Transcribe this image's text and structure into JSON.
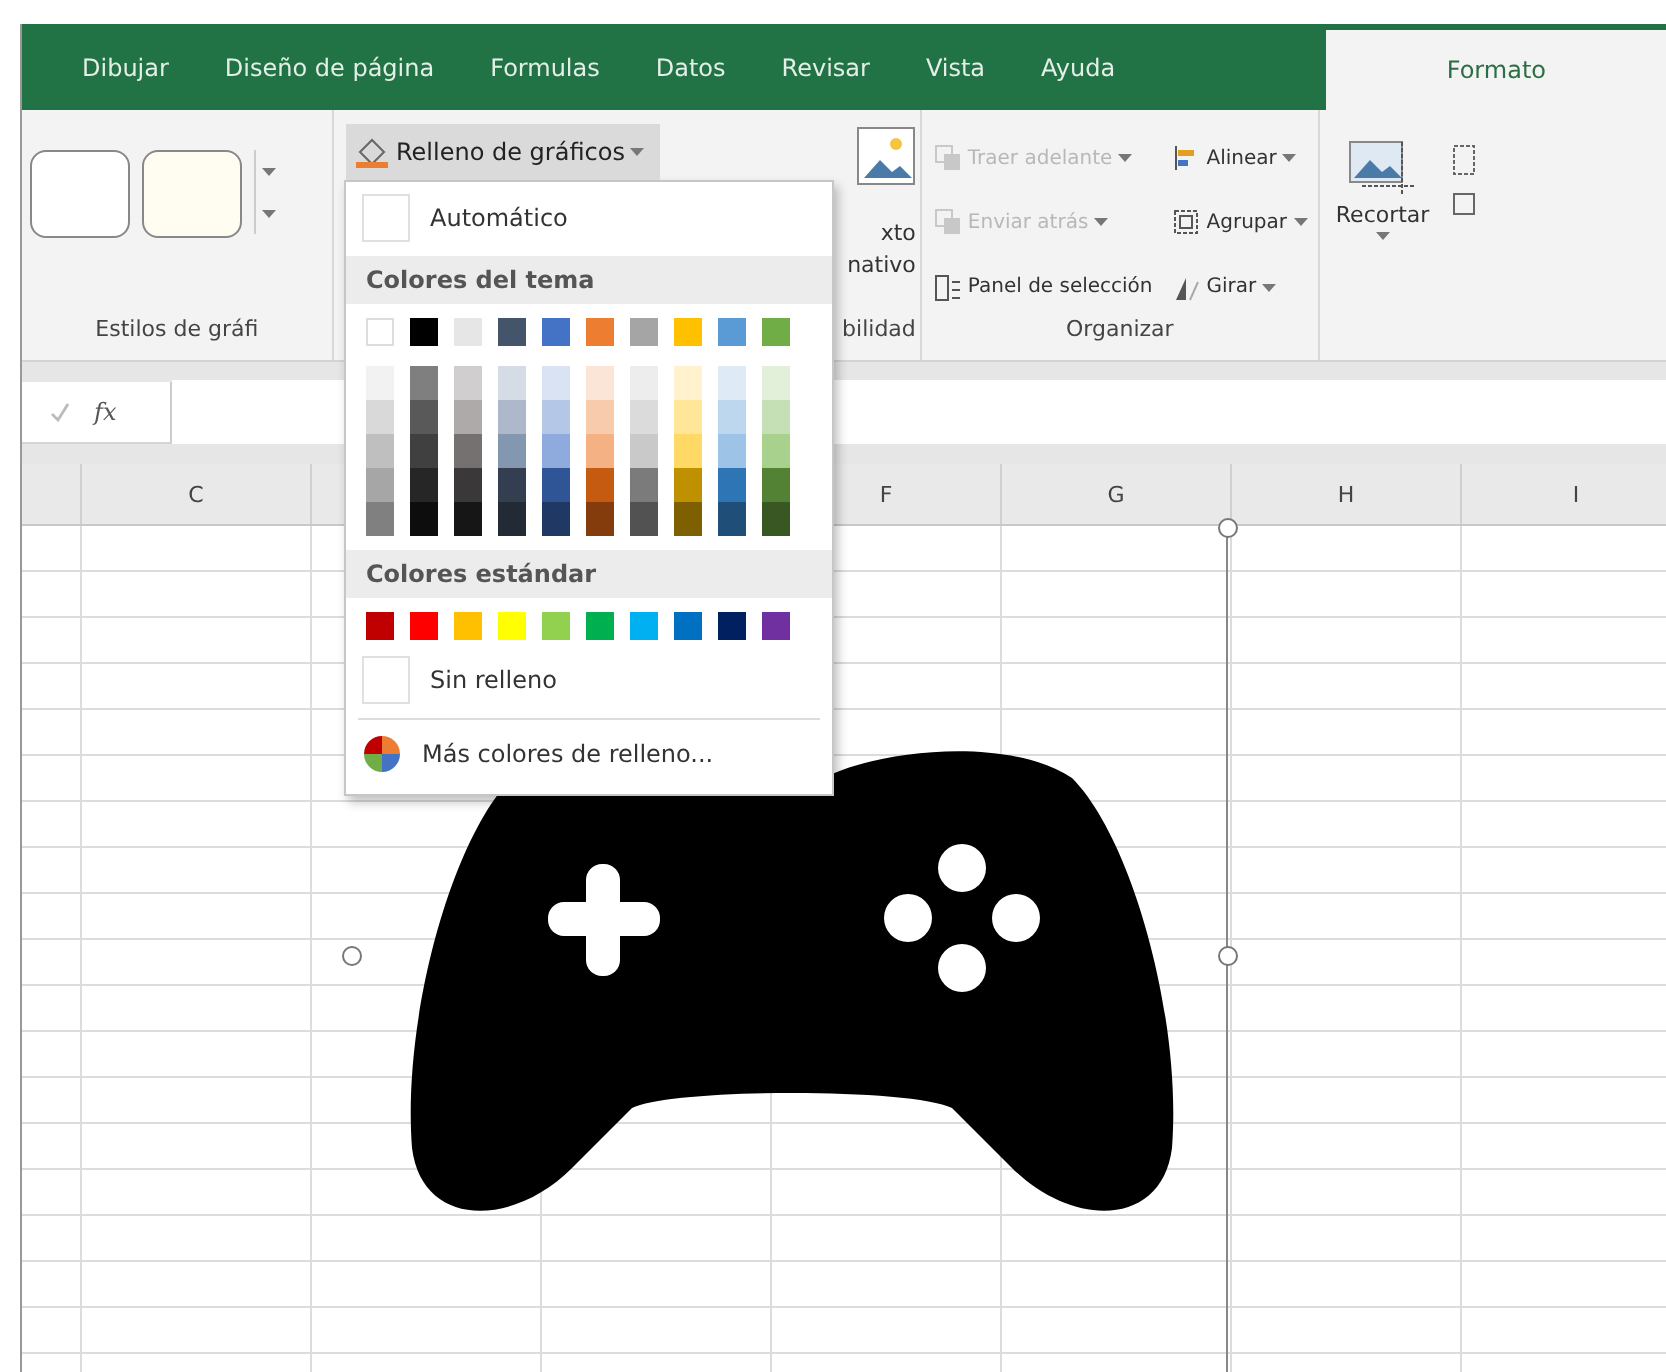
{
  "tabs": [
    {
      "label": "Dibujar",
      "selected": false
    },
    {
      "label": "Diseño de página",
      "selected": false
    },
    {
      "label": "Formulas",
      "selected": false
    },
    {
      "label": "Datos",
      "selected": false
    },
    {
      "label": "Revisar",
      "selected": false
    },
    {
      "label": "Vista",
      "selected": false
    },
    {
      "label": "Ayuda",
      "selected": false
    },
    {
      "label": "Formato",
      "selected": true
    }
  ],
  "ribbon": {
    "styles_group": {
      "label": "Estilos de gráfi"
    },
    "fill_button": {
      "label": "Relleno de gráficos",
      "expanded": true
    },
    "accessibility_group": {
      "line_1": "xto",
      "line_2": "nativo",
      "label": "bilidad"
    },
    "arrange_group": {
      "label": "Organizar",
      "items": [
        {
          "kind": "layer",
          "label": "Traer adelante",
          "disabled": true,
          "dropdown": true
        },
        {
          "kind": "layer",
          "label": "Enviar atrás",
          "disabled": true,
          "dropdown": true
        },
        {
          "kind": "pane",
          "label": "Panel de selección",
          "disabled": false,
          "dropdown": false
        },
        {
          "kind": "align",
          "label": "Alinear",
          "disabled": false,
          "dropdown": true
        },
        {
          "kind": "group",
          "label": "Agrupar",
          "disabled": false,
          "dropdown": true
        },
        {
          "kind": "rotate",
          "label": "Girar",
          "disabled": false,
          "dropdown": true
        }
      ]
    },
    "crop_button": {
      "label": "Recortar"
    }
  },
  "formula_bar": {
    "function_label": "fx"
  },
  "columns": [
    "C",
    "F",
    "G",
    "H",
    "I"
  ],
  "fill_menu": {
    "automatic": "Automático",
    "theme_header": "Colores del tema",
    "theme_colors": [
      {
        "color": "#ffffff",
        "shades": [
          {
            "color": "#f2f2f2"
          },
          {
            "color": "#d9d9d9"
          },
          {
            "color": "#bfbfbf"
          },
          {
            "color": "#a6a6a6"
          },
          {
            "color": "#808080"
          }
        ]
      },
      {
        "color": "#000000",
        "shades": [
          {
            "color": "#7f7f7f"
          },
          {
            "color": "#595959"
          },
          {
            "color": "#404040"
          },
          {
            "color": "#262626"
          },
          {
            "color": "#0d0d0d"
          }
        ]
      },
      {
        "color": "#e7e6e6",
        "shades": [
          {
            "color": "#d0cece"
          },
          {
            "color": "#aeaaaa"
          },
          {
            "color": "#757171"
          },
          {
            "color": "#3a3838"
          },
          {
            "color": "#171616"
          }
        ]
      },
      {
        "color": "#44546a",
        "shades": [
          {
            "color": "#d6dce5"
          },
          {
            "color": "#adb9ca"
          },
          {
            "color": "#8497b0"
          },
          {
            "color": "#333f50"
          },
          {
            "color": "#222a35"
          }
        ]
      },
      {
        "color": "#4472c4",
        "shades": [
          {
            "color": "#dae3f3"
          },
          {
            "color": "#b4c7e7"
          },
          {
            "color": "#8faadc"
          },
          {
            "color": "#2f5597"
          },
          {
            "color": "#203864"
          }
        ]
      },
      {
        "color": "#ed7d31",
        "shades": [
          {
            "color": "#fbe5d6"
          },
          {
            "color": "#f8cbad"
          },
          {
            "color": "#f4b183"
          },
          {
            "color": "#c55a11"
          },
          {
            "color": "#843c0c"
          }
        ]
      },
      {
        "color": "#a5a5a5",
        "shades": [
          {
            "color": "#ededed"
          },
          {
            "color": "#dbdbdb"
          },
          {
            "color": "#c9c9c9"
          },
          {
            "color": "#7b7b7b"
          },
          {
            "color": "#525252"
          }
        ]
      },
      {
        "color": "#ffc000",
        "shades": [
          {
            "color": "#fff2cc"
          },
          {
            "color": "#ffe699"
          },
          {
            "color": "#ffd966"
          },
          {
            "color": "#bf9000"
          },
          {
            "color": "#7f6000"
          }
        ]
      },
      {
        "color": "#5b9bd5",
        "shades": [
          {
            "color": "#deebf7"
          },
          {
            "color": "#bdd7ee"
          },
          {
            "color": "#9dc3e6"
          },
          {
            "color": "#2e75b6"
          },
          {
            "color": "#1f4e79"
          }
        ]
      },
      {
        "color": "#70ad47",
        "shades": [
          {
            "color": "#e2f0d9"
          },
          {
            "color": "#c5e0b4"
          },
          {
            "color": "#a9d18e"
          },
          {
            "color": "#548235"
          },
          {
            "color": "#385723"
          }
        ]
      }
    ],
    "standard_header": "Colores estándar",
    "standard_colors": [
      {
        "color": "#c00000"
      },
      {
        "color": "#ff0000"
      },
      {
        "color": "#ffc000"
      },
      {
        "color": "#ffff00"
      },
      {
        "color": "#92d050"
      },
      {
        "color": "#00b050"
      },
      {
        "color": "#00b0f0"
      },
      {
        "color": "#0070c0"
      },
      {
        "color": "#002060"
      },
      {
        "color": "#7030a0"
      }
    ],
    "no_fill": "Sin relleno",
    "more_colors": "Más colores de relleno..."
  }
}
